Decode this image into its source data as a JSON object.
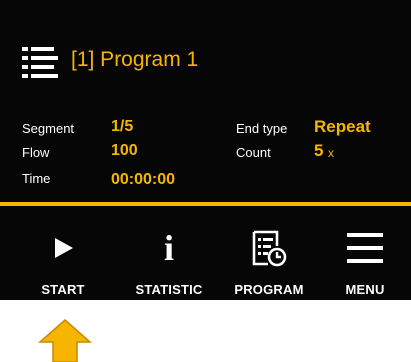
{
  "program": {
    "title": "[1] Program 1",
    "icon": "list-icon"
  },
  "status": {
    "segment_label": "Segment",
    "segment_value": "1/5",
    "flow_label": "Flow",
    "flow_value": "100",
    "time_label": "Time",
    "time_value": "00:00:00",
    "end_type_label": "End type",
    "end_type_value": "Repeat",
    "count_label": "Count",
    "count_value": "5",
    "count_unit": "x"
  },
  "nav": {
    "start_label": "START",
    "statistic_label": "STATISTIC",
    "program_label": "PROGRAM",
    "menu_label": "MENU"
  },
  "colors": {
    "accent": "#f6b600",
    "background": "#060606",
    "text": "#ffffff",
    "arrow": "#f6b600"
  }
}
